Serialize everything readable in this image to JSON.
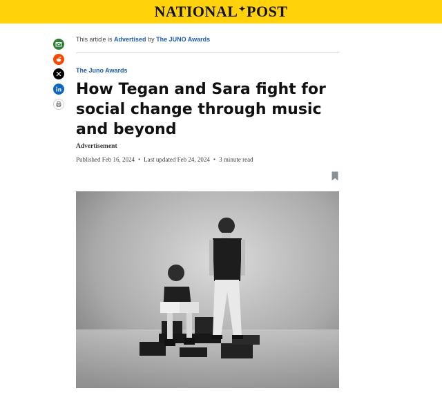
{
  "header": {
    "logo_left": "NATIONAL",
    "logo_right": "POST"
  },
  "share": [
    {
      "name": "email-share-button",
      "icon": "envelope-icon"
    },
    {
      "name": "reddit-share-button",
      "icon": "reddit-icon"
    },
    {
      "name": "x-share-button",
      "icon": "x-icon"
    },
    {
      "name": "linkedin-share-button",
      "icon": "linkedin-icon"
    },
    {
      "name": "print-button",
      "icon": "printer-icon"
    }
  ],
  "article": {
    "advertised_prefix": "This article is",
    "advertised_link": "Advertised",
    "advertised_by": "by",
    "sponsor": "The JUNO Awards",
    "kicker": "The Juno Awards",
    "headline": "How Tegan and Sara fight for social change through music and beyond",
    "ad_label": "Advertisement",
    "published": "Published Feb 16, 2024",
    "updated": "Last updated Feb 24, 2024",
    "read_time": "3 minute read"
  },
  "colors": {
    "brand_yellow": "#ffd20a",
    "link_blue": "#1a5bb8"
  }
}
